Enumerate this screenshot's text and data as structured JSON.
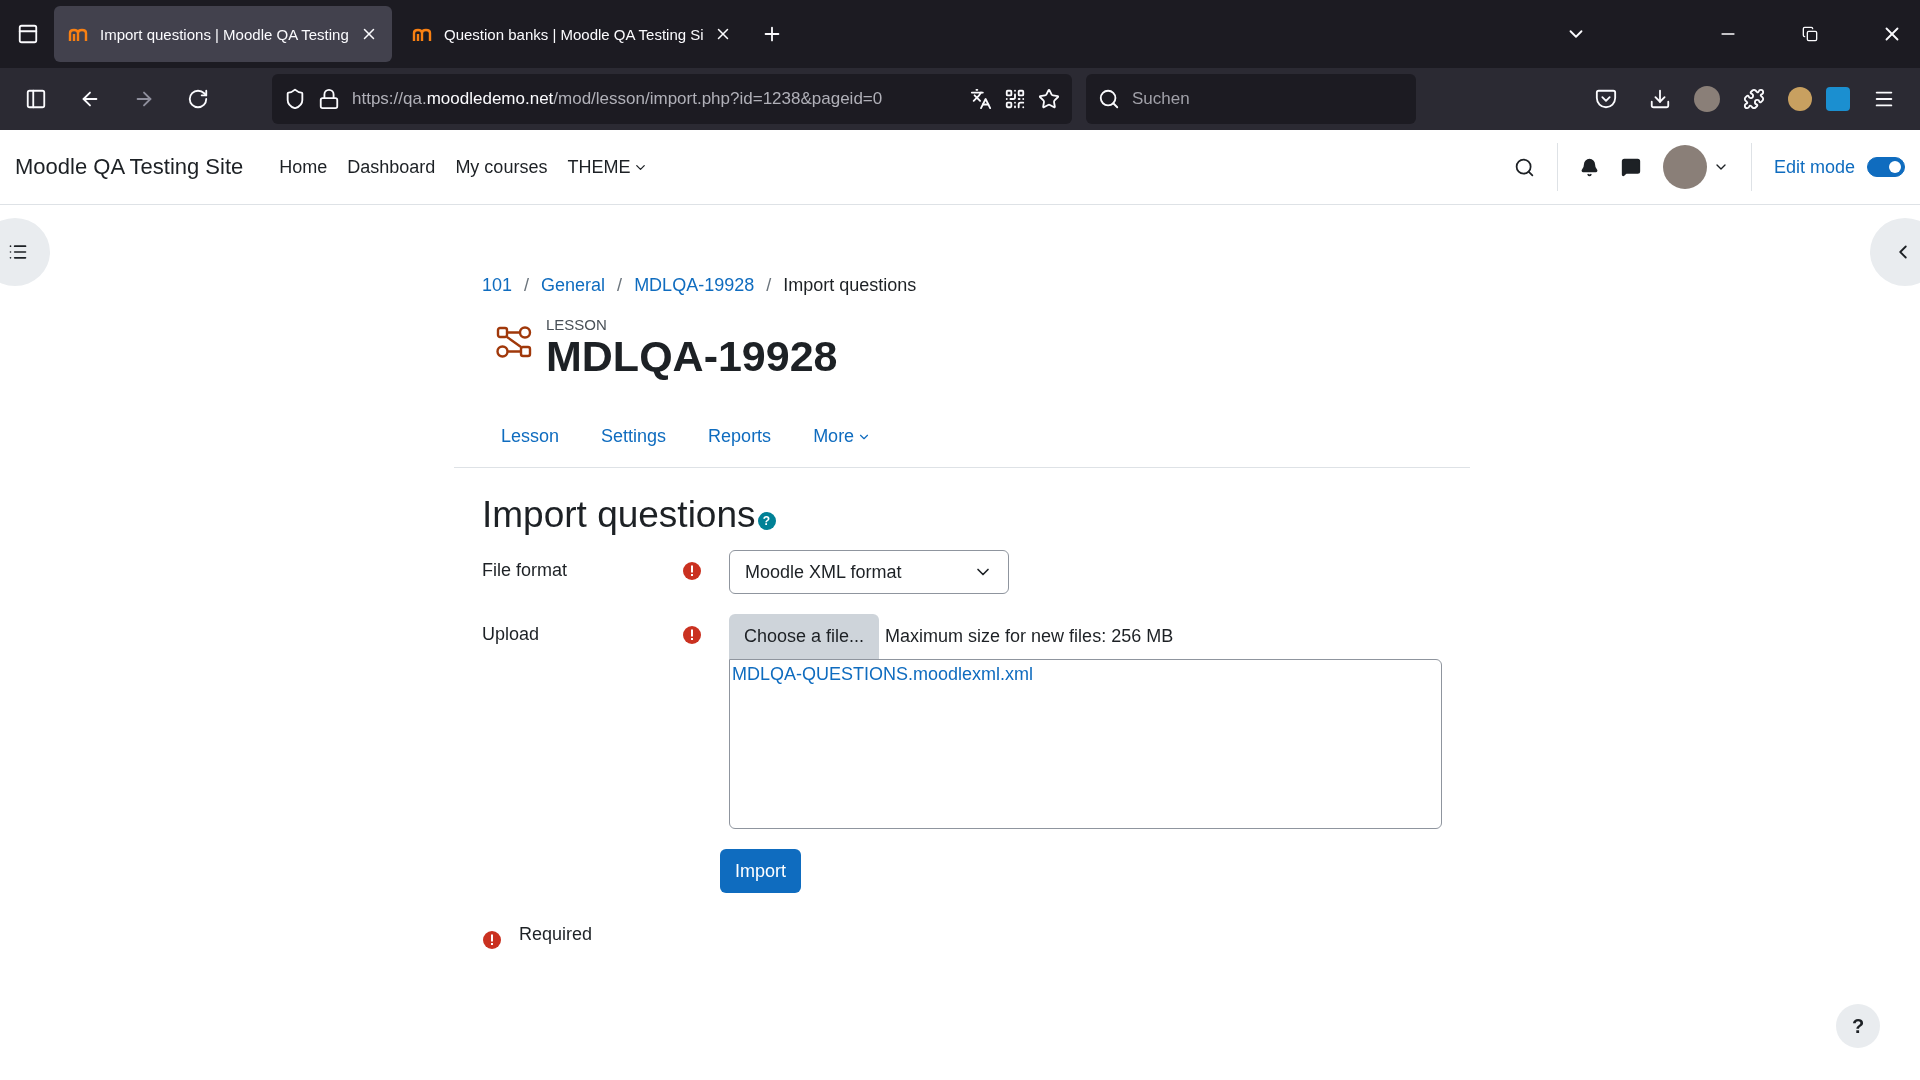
{
  "browser": {
    "tabs": [
      {
        "title": "Import questions | Moodle QA Testing",
        "selected": true
      },
      {
        "title": "Question banks | Moodle QA Testing Si",
        "selected": false
      }
    ],
    "url": {
      "scheme": "https://qa.",
      "domain": "moodledemo.net",
      "path": "/mod/lesson/import.php?id=1238&pageid=0"
    },
    "search": {
      "placeholder": "Suchen"
    }
  },
  "header": {
    "site_name": "Moodle QA Testing Site",
    "nav": [
      {
        "label": "Home",
        "dropdown": false
      },
      {
        "label": "Dashboard",
        "dropdown": false
      },
      {
        "label": "My courses",
        "dropdown": false
      },
      {
        "label": "THEME",
        "dropdown": true
      }
    ],
    "edit_mode": {
      "label": "Edit mode",
      "on": true
    }
  },
  "breadcrumb_separator": "/",
  "breadcrumb": [
    {
      "label": "101",
      "link": true
    },
    {
      "label": "General",
      "link": true
    },
    {
      "label": "MDLQA-19928",
      "link": true
    },
    {
      "label": "Import questions",
      "link": false
    }
  ],
  "activity": {
    "type": "LESSON",
    "title": "MDLQA-19928"
  },
  "secondary_nav": [
    {
      "label": "Lesson",
      "dropdown": false
    },
    {
      "label": "Settings",
      "dropdown": false
    },
    {
      "label": "Reports",
      "dropdown": false
    },
    {
      "label": "More",
      "dropdown": true
    }
  ],
  "form": {
    "heading": "Import questions",
    "help_icon": "?",
    "file_format": {
      "label": "File format",
      "required": true,
      "value": "Moodle XML format"
    },
    "upload": {
      "label": "Upload",
      "required": true,
      "button": "Choose a file...",
      "max_size": "Maximum size for new files: 256 MB",
      "files": [
        "MDLQA-QUESTIONS.moodlexml.xml"
      ]
    },
    "submit": "Import",
    "required_note": "Required"
  },
  "help": "?"
}
